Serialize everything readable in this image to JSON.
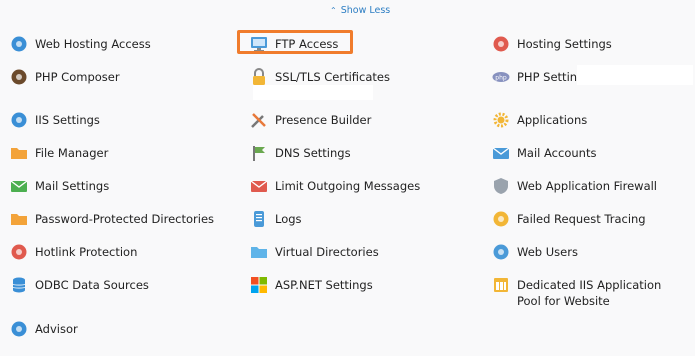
{
  "toggle": {
    "label": "Show Less",
    "icon": "chevron-up-icon"
  },
  "columns": [
    [
      {
        "label": "Web Hosting Access",
        "icon": "globe-icon",
        "color": "#3a8fd6"
      },
      {
        "label": "PHP Composer",
        "icon": "composer-icon",
        "color": "#6b4a2b"
      },
      {
        "label": "IIS Settings",
        "icon": "server-settings-icon",
        "color": "#3a8fd6"
      },
      {
        "label": "File Manager",
        "icon": "folder-icon",
        "color": "#f3a33a"
      },
      {
        "label": "Mail Settings",
        "icon": "mail-settings-icon",
        "color": "#4caf50"
      },
      {
        "label": "Password-Protected Directories",
        "icon": "locked-folder-icon",
        "color": "#f3a33a"
      },
      {
        "label": "Hotlink Protection",
        "icon": "hotlink-icon",
        "color": "#e05a4e"
      },
      {
        "label": "ODBC Data Sources",
        "icon": "database-icon",
        "color": "#3a8fd6"
      },
      {
        "label": "Advisor",
        "icon": "advisor-icon",
        "color": "#3a8fd6"
      }
    ],
    [
      {
        "label": "FTP Access",
        "icon": "ftp-monitor-icon",
        "color": "#4a9ad8"
      },
      {
        "label": "SSL/TLS Certificates",
        "icon": "padlock-icon",
        "color": "#f2b636"
      },
      {
        "label": "Presence Builder",
        "icon": "tools-icon",
        "color": "#e8793a"
      },
      {
        "label": "DNS Settings",
        "icon": "dns-icon",
        "color": "#6aa84f"
      },
      {
        "label": "Limit Outgoing Messages",
        "icon": "mail-limit-icon",
        "color": "#e05a4e"
      },
      {
        "label": "Logs",
        "icon": "logs-icon",
        "color": "#4a9ad8"
      },
      {
        "label": "Virtual Directories",
        "icon": "folder-icon",
        "color": "#5fb4e8"
      },
      {
        "label": "ASP.NET Settings",
        "icon": "windows-icon",
        "color": "#f25022"
      }
    ],
    [
      {
        "label": "Hosting Settings",
        "icon": "hosting-settings-icon",
        "color": "#e05a4e"
      },
      {
        "label": "PHP Settings",
        "icon": "php-icon",
        "color": "#8892bf"
      },
      {
        "label": "Applications",
        "icon": "gear-icon",
        "color": "#f2b636"
      },
      {
        "label": "Mail Accounts",
        "icon": "mail-icon",
        "color": "#4a9ad8"
      },
      {
        "label": "Web Application Firewall",
        "icon": "shield-icon",
        "color": "#9aa3ad"
      },
      {
        "label": "Failed Request Tracing",
        "icon": "trace-icon",
        "color": "#f2b636"
      },
      {
        "label": "Web Users",
        "icon": "web-users-icon",
        "color": "#4a9ad8"
      },
      {
        "label": "Dedicated IIS Application Pool for Website",
        "icon": "app-pool-icon",
        "color": "#f2b636"
      }
    ]
  ]
}
